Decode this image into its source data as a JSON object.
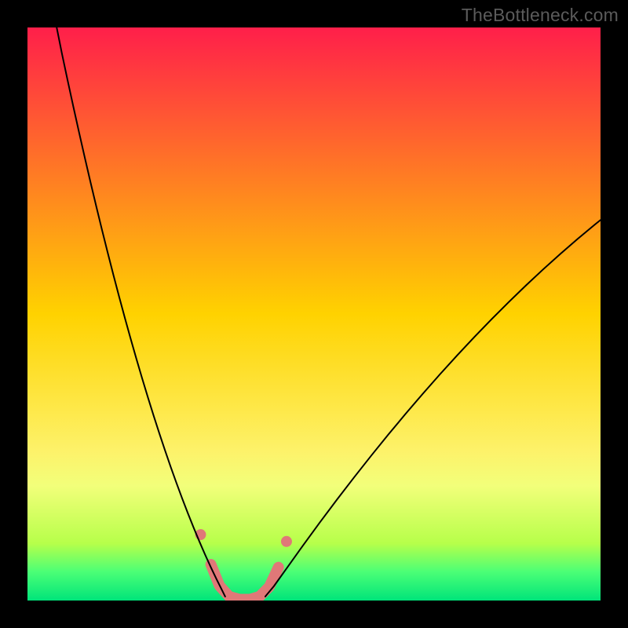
{
  "watermark": "TheBottleneck.com",
  "chart_data": {
    "type": "line",
    "title": "",
    "xlabel": "",
    "ylabel": "",
    "xlim": [
      0,
      100
    ],
    "ylim": [
      0,
      100
    ],
    "grid": false,
    "legend": false,
    "gradient_stops": [
      {
        "offset": 0.0,
        "color": "#ff1f4a"
      },
      {
        "offset": 0.5,
        "color": "#ffd200"
      },
      {
        "offset": 0.74,
        "color": "#fdf26a"
      },
      {
        "offset": 0.8,
        "color": "#f2ff7a"
      },
      {
        "offset": 0.9,
        "color": "#b7ff4a"
      },
      {
        "offset": 0.95,
        "color": "#4bff76"
      },
      {
        "offset": 1.0,
        "color": "#00e47a"
      }
    ],
    "series": [
      {
        "name": "left-curve",
        "color": "#000000",
        "width": 2,
        "x": [
          5.1,
          6,
          7,
          8,
          9,
          10,
          11,
          12,
          13,
          14,
          15,
          16,
          17,
          18,
          19,
          20,
          21,
          22,
          23,
          24,
          25,
          26,
          27,
          28,
          29,
          30,
          31,
          32,
          33,
          34,
          34.5
        ],
        "y": [
          100,
          95.5,
          90.8,
          86.2,
          81.7,
          77.3,
          73.0,
          68.8,
          64.7,
          60.7,
          56.8,
          53.0,
          49.3,
          45.7,
          42.2,
          38.8,
          35.5,
          32.3,
          29.2,
          26.2,
          23.3,
          20.5,
          17.8,
          15.2,
          12.7,
          10.3,
          8.0,
          5.8,
          3.7,
          1.7,
          0.7
        ]
      },
      {
        "name": "right-curve",
        "color": "#000000",
        "width": 2,
        "x": [
          41.5,
          43,
          45,
          48,
          51,
          54,
          57,
          60,
          63,
          66,
          69,
          72,
          75,
          78,
          81,
          84,
          87,
          90,
          93,
          96,
          99,
          100
        ],
        "y": [
          0.7,
          2.5,
          5.3,
          9.5,
          13.6,
          17.6,
          21.5,
          25.3,
          29.0,
          32.6,
          36.1,
          39.5,
          42.8,
          46.0,
          49.1,
          52.1,
          55.0,
          57.8,
          60.5,
          63.1,
          65.6,
          66.4
        ]
      },
      {
        "name": "highlight-band",
        "type": "scatter-line",
        "color": "#e07878",
        "width": 14,
        "marker_radius": 7,
        "x": [
          30.2,
          32.0,
          33.5,
          35.2,
          37.0,
          38.8,
          40.5,
          42.2,
          43.8,
          45.2
        ],
        "y": [
          11.5,
          6.3,
          2.6,
          0.7,
          0.2,
          0.2,
          0.7,
          2.4,
          5.8,
          10.3
        ]
      }
    ]
  }
}
